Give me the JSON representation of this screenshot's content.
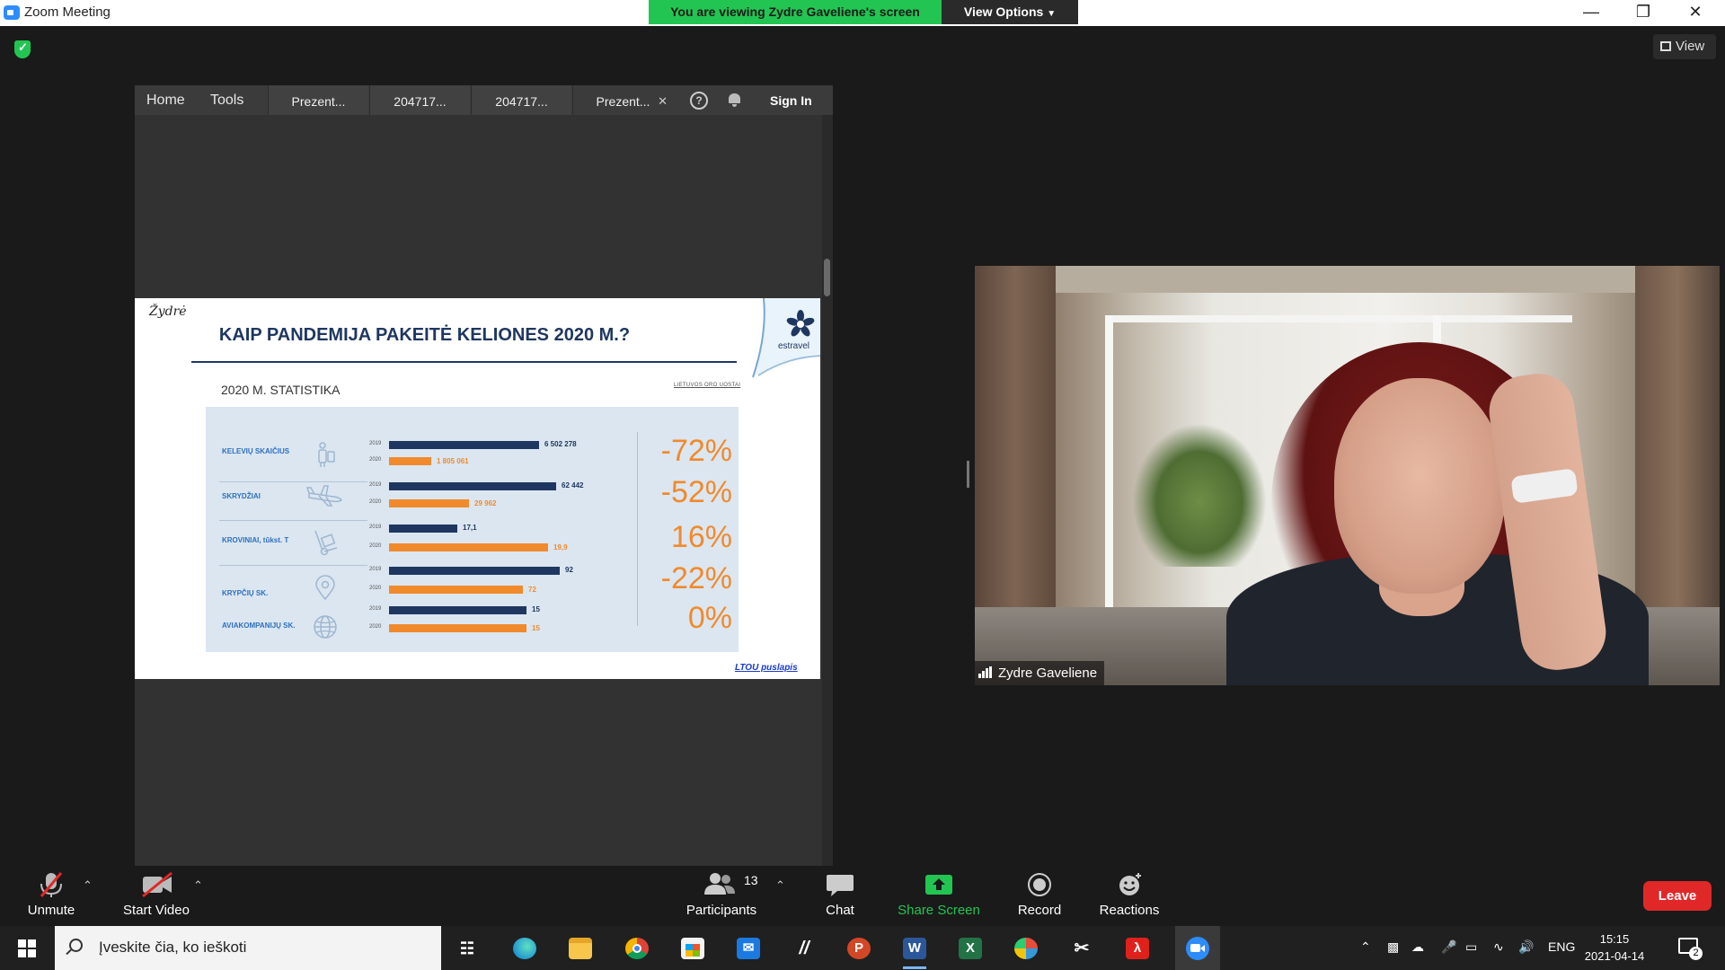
{
  "window": {
    "title": "Zoom Meeting",
    "share_banner": "You are viewing Zydre Gaveliene's screen",
    "view_options": "View Options",
    "view_button": "View",
    "minimize_icon": "minimize-icon",
    "restore_icon": "restore-icon",
    "close_icon": "close-icon"
  },
  "acrobat": {
    "nav": [
      "Home",
      "Tools"
    ],
    "tabs": [
      "Prezent...",
      "204717...",
      "204717...",
      "Prezent..."
    ],
    "active_tab": 3,
    "help": "?",
    "signin": "Sign In"
  },
  "slide": {
    "author": "Žydrė",
    "title": "KAIP PANDEMIJA PAKEITĖ KELIONES 2020 M.?",
    "subtitle": "2020 M. STATISTIKA",
    "source_note": "LIETUVOS ORO UOSTAI",
    "logo_text": "estravel",
    "link": "LTOU puslapis",
    "year_2019": "2019",
    "year_2020": "2020",
    "rows": [
      {
        "label": "KELEVIŲ SKAIČIUS",
        "icon": "traveler-icon",
        "value_2019": "6 502 278",
        "value_2020": "1 805 061",
        "fraction_2019": 0.9,
        "fraction_2020": 0.25,
        "change": "-72%"
      },
      {
        "label": "SKRYDŽIAI",
        "icon": "airplane-icon",
        "value_2019": "62 442",
        "value_2020": "29 962",
        "fraction_2019": 1.0,
        "fraction_2020": 0.48,
        "change": "-52%"
      },
      {
        "label": "KROVINIAI, tūkst. T",
        "icon": "cargo-cart-icon",
        "value_2019": "17,1",
        "value_2020": "19,9",
        "fraction_2019": 0.41,
        "fraction_2020": 0.95,
        "change": "16%"
      },
      {
        "label": "KRYPČIŲ SK.",
        "icon": "location-pin-icon",
        "value_2019": "92",
        "value_2020": "72",
        "fraction_2019": 1.02,
        "fraction_2020": 0.8,
        "change": "-22%"
      },
      {
        "label": "AVIAKOMPANIJŲ SK.",
        "icon": "globe-icon",
        "value_2019": "15",
        "value_2020": "15",
        "fraction_2019": 0.82,
        "fraction_2020": 0.82,
        "change": "0%"
      }
    ]
  },
  "video": {
    "participant_name": "Zydre Gaveliene"
  },
  "controls": {
    "unmute": "Unmute",
    "start_video": "Start Video",
    "participants": "Participants",
    "participants_count": "13",
    "chat": "Chat",
    "share_screen": "Share Screen",
    "record": "Record",
    "reactions": "Reactions",
    "leave": "Leave"
  },
  "taskbar": {
    "search_placeholder": "Įveskite čia, ko ieškoti",
    "language": "ENG",
    "time": "15:15",
    "date": "2021-04-14",
    "notification_count": "2",
    "apps": [
      "task-view-icon",
      "edge-icon",
      "file-explorer-icon",
      "chrome-icon",
      "store-icon",
      "mail-icon",
      "pen-app-icon",
      "powerpoint-icon",
      "word-icon",
      "excel-icon",
      "paint-icon",
      "snip-icon",
      "acrobat-icon",
      "zoom-icon"
    ]
  },
  "colors": {
    "banner_green": "#23c552",
    "bar_2019": "#1f3760",
    "bar_2020": "#f08a2c",
    "leave_red": "#e02828",
    "share_green": "#23c552"
  }
}
